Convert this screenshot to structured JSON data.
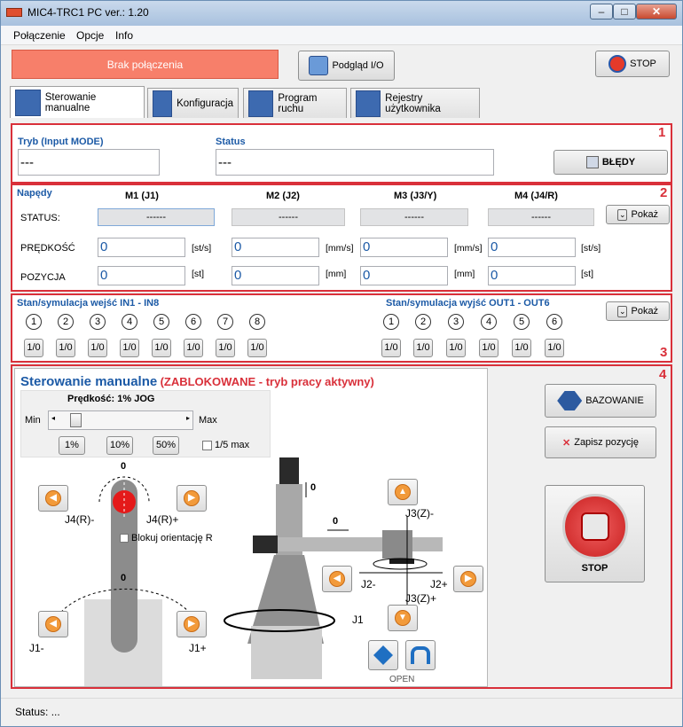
{
  "window": {
    "title": "MIC4-TRC1 PC  ver.: 1.20"
  },
  "menu": [
    "Połączenie",
    "Opcje",
    "Info"
  ],
  "toolbar": {
    "connection": "Brak połączenia",
    "io_preview": "Podgląd I/O",
    "stop": "STOP"
  },
  "tabs": [
    "Sterowanie manualne",
    "Konfiguracja",
    "Program ruchu",
    "Rejestry użytkownika"
  ],
  "panel1": {
    "num": "1",
    "mode_label": "Tryb (Input MODE)",
    "mode_value": "---",
    "status_label": "Status",
    "status_value": "---",
    "errors_button": "BŁĘDY"
  },
  "panel2": {
    "num": "2",
    "title": "Napędy",
    "headers": [
      "M1 (J1)",
      "M2 (J2)",
      "M3 (J3/Y)",
      "M4 (J4/R)"
    ],
    "row_status": "STATUS:",
    "row_speed": "PRĘDKOŚĆ",
    "row_pos": "POZYCJA",
    "status_values": [
      "------",
      "------",
      "------",
      "------"
    ],
    "speed_values": [
      "0",
      "0",
      "0",
      "0"
    ],
    "pos_values": [
      "0",
      "0",
      "0",
      "0"
    ],
    "speed_units": [
      "[st/s]",
      "[mm/s]",
      "[mm/s]",
      "[st/s]"
    ],
    "pos_units": [
      "[st]",
      "[mm]",
      "[mm]",
      "[st]"
    ],
    "show_button": "Pokaż"
  },
  "panel3": {
    "num": "3",
    "inputs_title": "Stan/symulacja wejść IN1 - IN8",
    "outputs_title": "Stan/symulacja wyjść OUT1 - OUT6",
    "inputs": [
      "1",
      "2",
      "3",
      "4",
      "5",
      "6",
      "7",
      "8"
    ],
    "outputs": [
      "1",
      "2",
      "3",
      "4",
      "5",
      "6"
    ],
    "io_label": "1/0",
    "show_button": "Pokaż"
  },
  "panel4": {
    "num": "4",
    "title": "Sterowanie manualne",
    "locked": "(ZABLOKOWANE - tryb pracy aktywny)",
    "speed_label": "Prędkość:  1% JOG",
    "slider_level": 0.1,
    "min": "Min",
    "max": "Max",
    "presets": [
      "1%",
      "10%",
      "50%"
    ],
    "fifth_max": "1/5 max",
    "lock_orientation": "Blokuj orientację R",
    "j4_minus": "J4(R)-",
    "j4_plus": "J4(R)+",
    "j1_minus": "J1-",
    "j1_plus": "J1+",
    "j1": "J1",
    "j2_minus": "J2-",
    "j2_plus": "J2+",
    "j3_minus": "J3(Z)-",
    "j3_plus": "J3(Z)+",
    "zero": "0",
    "open": "OPEN",
    "homing": "BAZOWANIE",
    "save_pos": "Zapisz pozycję",
    "stop": "STOP"
  },
  "statusbar": {
    "text": "Status:  ..."
  }
}
